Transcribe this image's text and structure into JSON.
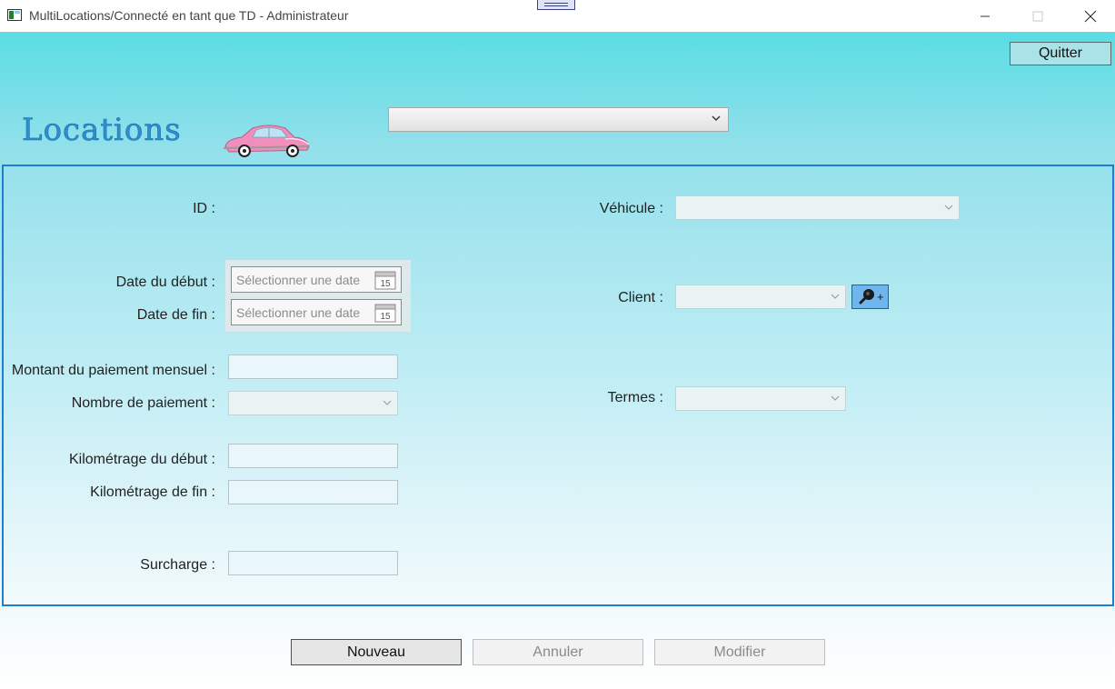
{
  "window": {
    "title": "MultiLocations/Connecté en tant que TD - Administrateur",
    "controls": [
      "minimize-icon",
      "maximize-icon",
      "close-icon"
    ]
  },
  "header": {
    "quit_label": "Quitter",
    "title": "Locations",
    "selector_value": ""
  },
  "form": {
    "id_label": "ID :",
    "start_date_label": "Date du début :",
    "end_date_label": "Date de fin :",
    "start_date_placeholder": "Sélectionner une date",
    "end_date_placeholder": "Sélectionner une date",
    "calendar_day": "15",
    "monthly_payment_label": "Montant du paiement mensuel :",
    "payment_count_label": "Nombre de paiement :",
    "start_km_label": "Kilométrage du début :",
    "end_km_label": "Kilométrage de fin :",
    "surcharge_label": "Surcharge :",
    "vehicle_label": "Véhicule :",
    "client_label": "Client :",
    "terms_label": "Termes :",
    "monthly_payment_value": "",
    "start_km_value": "",
    "end_km_value": "",
    "surcharge_value": ""
  },
  "actions": {
    "new_label": "Nouveau",
    "cancel_label": "Annuler",
    "modify_label": "Modifier"
  },
  "colors": {
    "accent_blue": "#1f7fcf",
    "title_blue": "#2d8fcf",
    "gradient_top": "#5adde3",
    "search_button": "#6fb6ee"
  }
}
